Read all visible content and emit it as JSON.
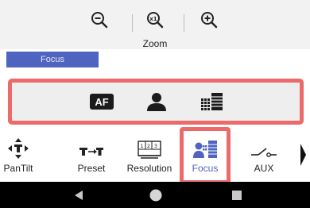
{
  "zoom": {
    "label": "Zoom",
    "zoom_out_icon": "zoom-out-icon",
    "zoom_reset_icon": "zoom-x1-icon",
    "zoom_in_icon": "zoom-in-icon"
  },
  "section": {
    "active_tab": "Focus",
    "accent_color": "#4f63c0"
  },
  "focus_modes": [
    {
      "id": "af",
      "text": "AF",
      "icon": "autofocus-icon"
    },
    {
      "id": "face",
      "icon": "person-icon"
    },
    {
      "id": "grid",
      "icon": "focus-area-grid-icon"
    }
  ],
  "toolbar": {
    "items": [
      {
        "label": "PanTilt",
        "icon": "pan-tilt-icon"
      },
      {
        "label": "Preset",
        "icon": "preset-icon"
      },
      {
        "label": "Resolution",
        "icon": "resolution-icon"
      },
      {
        "label": "Focus",
        "icon": "focus-icon",
        "active": true
      },
      {
        "label": "AUX",
        "icon": "aux-switch-icon"
      }
    ],
    "more_icon": "chevron-right-icon",
    "highlight_color": "#ec6a6a"
  },
  "navbar": {
    "back_icon": "back-triangle-icon",
    "home_icon": "home-circle-icon",
    "recents_icon": "recents-square-icon"
  }
}
